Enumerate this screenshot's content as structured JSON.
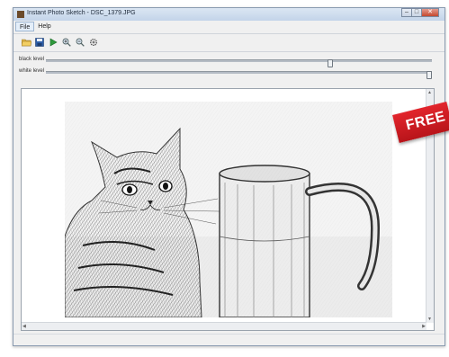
{
  "window": {
    "title": "Instant Photo Sketch - DSC_1379.JPG",
    "controls": {
      "minimize": "–",
      "maximize": "□",
      "close": "✕"
    }
  },
  "menubar": {
    "items": [
      {
        "label": "File"
      },
      {
        "label": "Help"
      }
    ]
  },
  "toolbar": {
    "icons": [
      "open-folder-icon",
      "save-icon",
      "run-icon",
      "zoom-in-icon",
      "zoom-out-icon",
      "settings-icon"
    ]
  },
  "sliders": [
    {
      "label": "black level",
      "value": 0.74
    },
    {
      "label": "white level",
      "value": 1.0
    }
  ],
  "badge": {
    "text": "FREE",
    "color": "#d11f26"
  },
  "canvas": {
    "image": "pencil-sketch-of-cat-and-glass-pitcher"
  }
}
